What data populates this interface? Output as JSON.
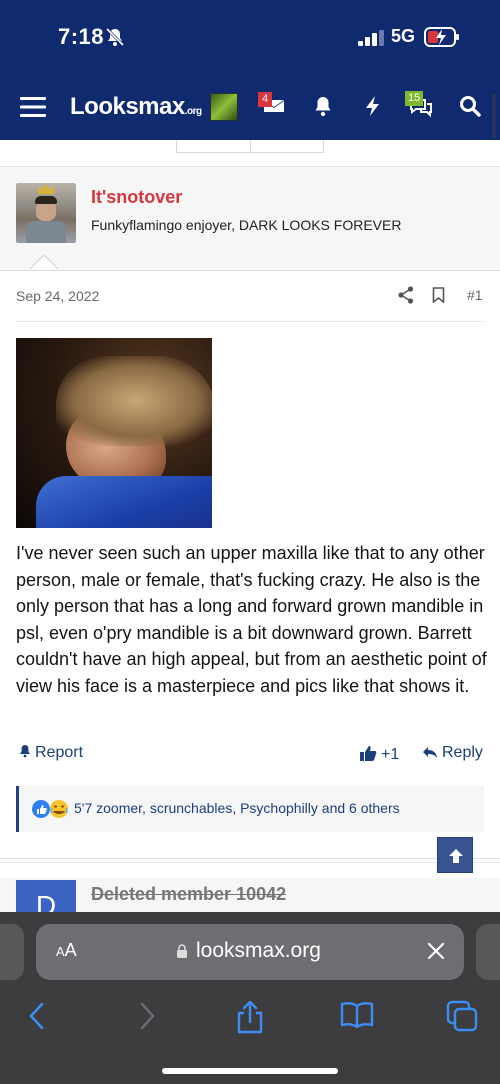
{
  "status_bar": {
    "time": "7:18",
    "network": "5G"
  },
  "nav": {
    "logo_main": "Looksmax",
    "logo_suffix": ".org",
    "inbox_badge": "4",
    "conversations_badge": "15"
  },
  "post": {
    "author": "It'snotover",
    "author_title": "Funkyflamingo enjoyer, DARK LOOKS FOREVER",
    "date": "Sep 24, 2022",
    "number": "#1",
    "body": "I've never seen such an upper maxilla like that to any other person, male or female, that's fucking crazy. He also is the only person that has a long and forward grown mandible in psl, even o'pry mandible is a bit downward grown. Barrett couldn't have an high appeal, but from an aesthetic point of view his face is a masterpiece and pics like that shows it.",
    "report_label": "Report",
    "like_count": "+1",
    "reply_label": "Reply",
    "reactions_text": "5'7 zoomer, scrunchables, Psychophilly and 6 others"
  },
  "next_post": {
    "avatar_letter": "D",
    "author": "Deleted member 10042"
  },
  "safari": {
    "aa_small": "A",
    "aa_large": "A",
    "url": "looksmax.org"
  },
  "colors": {
    "header_bg": "#0f2a6e",
    "author_red": "#d8373e",
    "link_blue": "#1d3f7a"
  }
}
